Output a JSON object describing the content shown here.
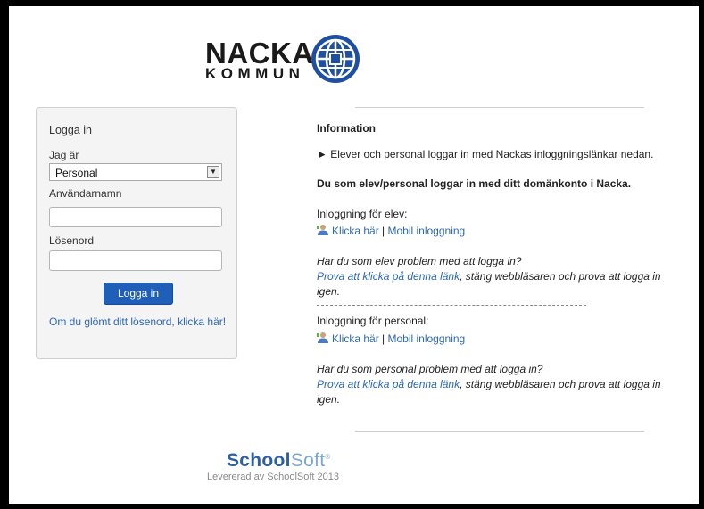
{
  "brand": {
    "line1": "NACKA",
    "line2": "KOMMUN",
    "colors": {
      "globe_outer": "#1e4fa3",
      "globe_inner": "#ffffff"
    }
  },
  "login": {
    "title": "Logga in",
    "role_label": "Jag är",
    "role_value": "Personal",
    "username_label": "Användarnamn",
    "password_label": "Lösenord",
    "username_value": "",
    "password_value": "",
    "submit_label": "Logga in",
    "forgot_text": "Om du glömt ditt lösenord, klicka här!",
    "colors": {
      "button": "#1f5fb8",
      "link": "#2b67b8"
    }
  },
  "info": {
    "heading": "Information",
    "bullet": "► Elever och personal loggar in med Nackas inloggningslänkar nedan.",
    "domain_note": "Du som elev/personal loggar in med ditt domänkonto i Nacka.",
    "student_heading": "Inloggning för elev:",
    "student_click": "Klicka här",
    "student_sep": " | ",
    "student_mobile": "Mobil inloggning",
    "student_problem": "Har du som elev problem med att logga in?",
    "student_try_link": "Prova att klicka på denna länk",
    "student_try_rest": ", stäng webbläsaren och prova att logga in igen.",
    "staff_heading": "Inloggning för personal:",
    "staff_click": "Klicka här",
    "staff_sep": " | ",
    "staff_mobile": "Mobil inloggning",
    "staff_problem": "Har du som personal problem med att logga in?",
    "staff_try_link": "Prova att klicka på denna länk",
    "staff_try_rest": ", stäng webbläsaren och prova att logga in igen.",
    "user_icon": "user-icon"
  },
  "footer": {
    "logo_bold": "School",
    "logo_light": "Soft",
    "logo_reg": "®",
    "delivered": "Levererad av SchoolSoft 2013"
  }
}
